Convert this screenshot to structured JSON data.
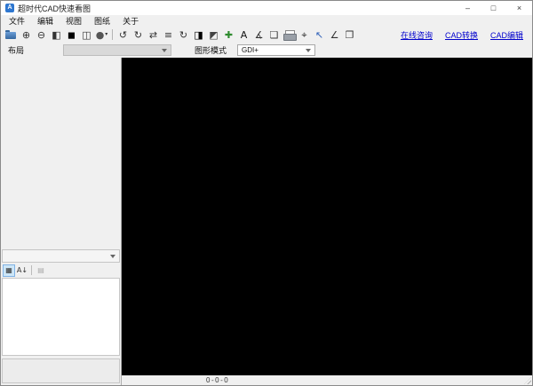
{
  "window": {
    "title": "超时代CAD快速看图",
    "app_icon_letter": "A",
    "controls": {
      "minimize": "–",
      "maximize": "□",
      "close": "×"
    }
  },
  "menu": {
    "items": [
      {
        "id": "file",
        "label": "文件"
      },
      {
        "id": "edit",
        "label": "编辑"
      },
      {
        "id": "view",
        "label": "视图"
      },
      {
        "id": "sheet",
        "label": "图纸"
      },
      {
        "id": "about",
        "label": "关于"
      }
    ]
  },
  "toolbar": {
    "icons": [
      {
        "name": "open-file-icon",
        "glyph": ""
      },
      {
        "name": "zoom-in-icon",
        "glyph": "⊕"
      },
      {
        "name": "zoom-out-icon",
        "glyph": "⊖"
      },
      {
        "name": "zoom-window-icon",
        "glyph": "◧"
      },
      {
        "name": "background-toggle-icon",
        "glyph": "◼",
        "color": "#000000"
      },
      {
        "name": "pan-icon",
        "glyph": "◫"
      },
      {
        "name": "color-mode-icon",
        "glyph": "●",
        "color": "#555555",
        "dropdown": true
      },
      {
        "separator": true
      },
      {
        "name": "rotate-left-icon",
        "glyph": "↺"
      },
      {
        "name": "rotate-right-icon",
        "glyph": "↻"
      },
      {
        "name": "mirror-icon",
        "glyph": "⇄"
      },
      {
        "name": "layer-manager-icon",
        "glyph": "≡"
      },
      {
        "name": "refresh-icon",
        "glyph": "↻"
      },
      {
        "name": "invert-colors-icon",
        "glyph": "◨",
        "color": "#000000"
      },
      {
        "name": "grayscale-icon",
        "glyph": "◩",
        "color": "#444444"
      },
      {
        "name": "zoom-extents-icon",
        "glyph": "✚",
        "color": "#2e8b2e"
      },
      {
        "name": "text-find-icon",
        "glyph": "A",
        "color": "#111111"
      },
      {
        "name": "dimension-icon",
        "glyph": "∡"
      },
      {
        "name": "drawing-list-icon",
        "glyph": "❏"
      },
      {
        "name": "print-icon",
        "glyph": ""
      },
      {
        "name": "print-preview-icon",
        "glyph": "⌖"
      },
      {
        "name": "select-icon",
        "glyph": "↖",
        "color": "#2e5fb8"
      },
      {
        "name": "measure-icon",
        "glyph": "∠"
      },
      {
        "name": "copy-icon",
        "glyph": "❐"
      }
    ],
    "links": [
      {
        "id": "online-support",
        "label": "在线咨询"
      },
      {
        "id": "cad-convert",
        "label": "CAD转换"
      },
      {
        "id": "cad-edit",
        "label": "CAD编辑"
      }
    ]
  },
  "optionsbar": {
    "layout_label": "布局",
    "layout_value": "",
    "mode_label": "图形模式",
    "mode_value": "GDI+"
  },
  "sidebar": {
    "propgrid_buttons": [
      {
        "name": "categorized-button",
        "glyph": "▦",
        "selected": true
      },
      {
        "name": "alphabetical-button",
        "glyph": "A↓"
      },
      {
        "separator": true
      },
      {
        "name": "property-pages-button",
        "glyph": "▤",
        "disabled": true
      }
    ]
  },
  "statusbar": {
    "coordinates": "0-0-0"
  },
  "colors": {
    "link": "#0000cc",
    "canvas": "#000000",
    "accent_blue": "#2e77d0",
    "selected_bg": "#cde6f7",
    "selected_border": "#7fb2e5"
  }
}
